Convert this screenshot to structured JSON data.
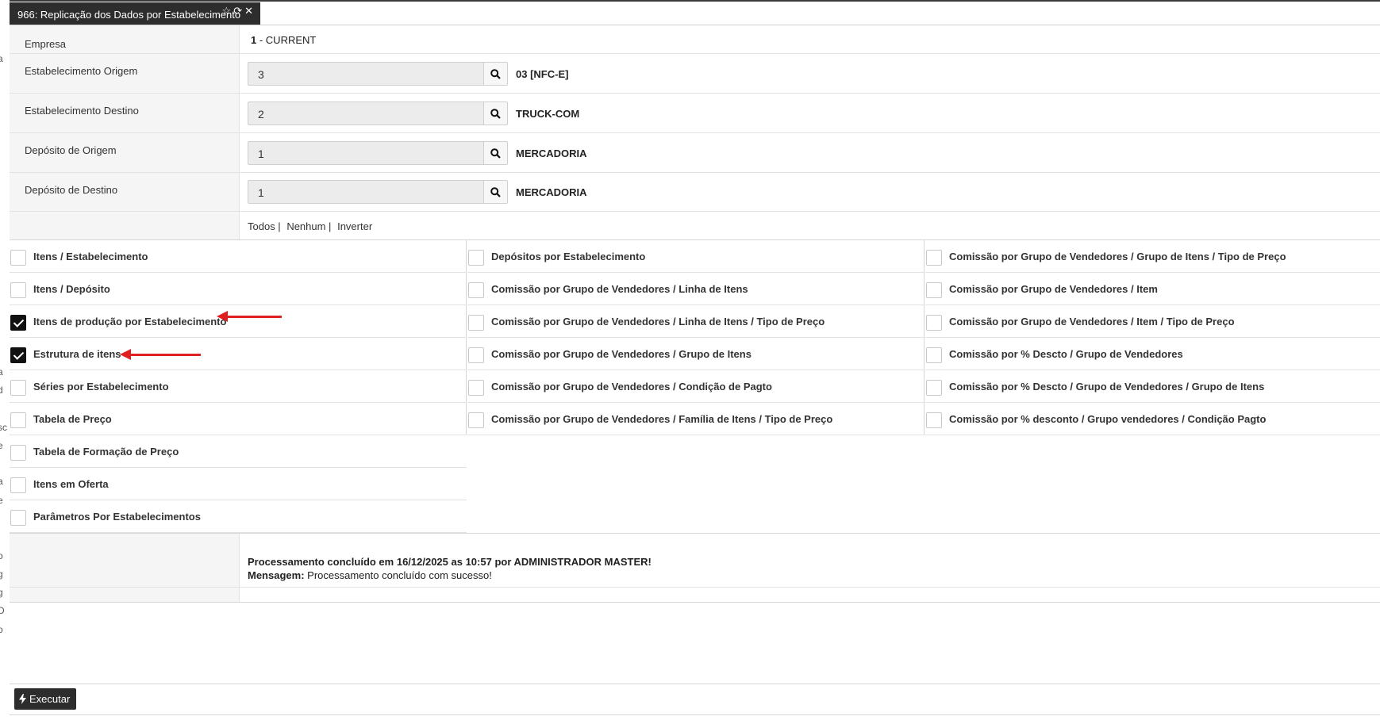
{
  "tab": {
    "title": "966: Replicação dos Dados por Estabelecimento",
    "icons": [
      "star-icon",
      "refresh-icon",
      "close-icon"
    ]
  },
  "left_gutter_fragments": [
    "a",
    "a",
    "d",
    "sc",
    "e",
    "a",
    "e",
    "o",
    "g",
    "g",
    "D",
    "o"
  ],
  "form": {
    "empresa": {
      "label": "Empresa",
      "value_prefix": "1",
      "value": " - CURRENT"
    },
    "est_origem": {
      "label": "Estabelecimento Origem",
      "value": "3",
      "desc": "03 [NFC-E]"
    },
    "est_destino": {
      "label": "Estabelecimento Destino",
      "value": "2",
      "desc": "TRUCK-COM"
    },
    "dep_origem": {
      "label": "Depósito de Origem",
      "value": "1",
      "desc": "MERCADORIA"
    },
    "dep_destino": {
      "label": "Depósito de Destino",
      "value": "1",
      "desc": "MERCADORIA"
    },
    "select_links": {
      "todos": "Todos |",
      "nenhum": "Nenhum |",
      "inverter": "Inverter"
    }
  },
  "checkboxes": {
    "col1": [
      {
        "label": "Itens / Estabelecimento",
        "checked": false
      },
      {
        "label": "Itens / Depósito",
        "checked": false
      },
      {
        "label": "Itens de produção por Estabelecimento",
        "checked": true
      },
      {
        "label": "Estrutura de itens",
        "checked": true
      },
      {
        "label": "Séries por Estabelecimento",
        "checked": false
      },
      {
        "label": "Tabela de Preço",
        "checked": false
      },
      {
        "label": "Tabela de Formação de Preço",
        "checked": false
      },
      {
        "label": "Itens em Oferta",
        "checked": false
      },
      {
        "label": "Parâmetros Por Estabelecimentos",
        "checked": false
      }
    ],
    "col2": [
      {
        "label": "Depósitos por Estabelecimento",
        "checked": false
      },
      {
        "label": "Comissão por Grupo de Vendedores / Linha de Itens",
        "checked": false
      },
      {
        "label": "Comissão por Grupo de Vendedores / Linha de Itens / Tipo de Preço",
        "checked": false
      },
      {
        "label": "Comissão por Grupo de Vendedores / Grupo de Itens",
        "checked": false
      },
      {
        "label": "Comissão por Grupo de Vendedores / Condição de Pagto",
        "checked": false
      },
      {
        "label": "Comissão por Grupo de Vendedores / Família de Itens / Tipo de Preço",
        "checked": false
      }
    ],
    "col3": [
      {
        "label": "Comissão por Grupo de Vendedores / Grupo de Itens / Tipo de Preço",
        "checked": false
      },
      {
        "label": "Comissão por Grupo de Vendedores / Item",
        "checked": false
      },
      {
        "label": "Comissão por Grupo de Vendedores / Item / Tipo de Preço",
        "checked": false
      },
      {
        "label": "Comissão por % Descto / Grupo de Vendedores",
        "checked": false
      },
      {
        "label": "Comissão por % Descto / Grupo de Vendedores / Grupo de Itens",
        "checked": false
      },
      {
        "label": "Comissão por % desconto / Grupo vendedores / Condição Pagto",
        "checked": false
      }
    ]
  },
  "message": {
    "line1": "Processamento concluído em 16/12/2025 as 10:57 por ADMINISTRADOR MASTER!",
    "line2_label": "Mensagem:",
    "line2_text": " Processamento concluído com sucesso!"
  },
  "footer": {
    "execute_label": "Executar"
  },
  "colors": {
    "dark": "#2d2d2d",
    "annotation_arrow": "#e02020",
    "label_bg": "#f5f5f5"
  }
}
